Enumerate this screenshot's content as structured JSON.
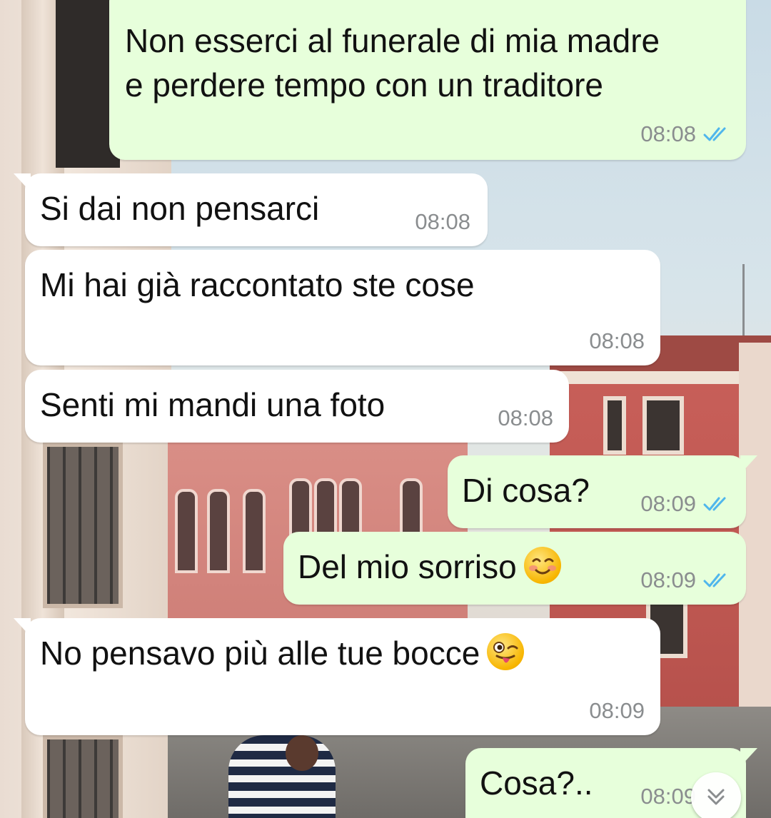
{
  "messages": [
    {
      "id": "m1",
      "direction": "outgoing",
      "lines": [
        "Non esserci al funerale di mia madre",
        "e perdere tempo con un traditore"
      ],
      "time": "08:08",
      "status": "read"
    },
    {
      "id": "m2",
      "direction": "incoming",
      "text": "Si dai non pensarci",
      "time": "08:08"
    },
    {
      "id": "m3",
      "direction": "incoming",
      "text": "Mi hai già raccontato ste cose",
      "time": "08:08"
    },
    {
      "id": "m4",
      "direction": "incoming",
      "text": "Senti mi mandi una foto",
      "time": "08:08"
    },
    {
      "id": "m5",
      "direction": "outgoing",
      "text": "Di cosa?",
      "time": "08:09",
      "status": "read"
    },
    {
      "id": "m6",
      "direction": "outgoing",
      "text": "Del mio sorriso",
      "emoji": "smiling-face-emoji",
      "time": "08:09",
      "status": "read"
    },
    {
      "id": "m7",
      "direction": "incoming",
      "text": "No pensavo più alle tue bocce",
      "emoji": "winking-tongue-emoji",
      "time": "08:09"
    },
    {
      "id": "m8",
      "direction": "outgoing",
      "text": "Cosa?..",
      "time": "08:09",
      "status": "read"
    }
  ],
  "colors": {
    "incoming_bubble": "#ffffff",
    "outgoing_bubble": "#e7ffdb",
    "read_ticks": "#4fb6ec",
    "timestamp": "#8a8d8f"
  },
  "scroll_button": {
    "icon": "double-chevron-down-icon"
  }
}
